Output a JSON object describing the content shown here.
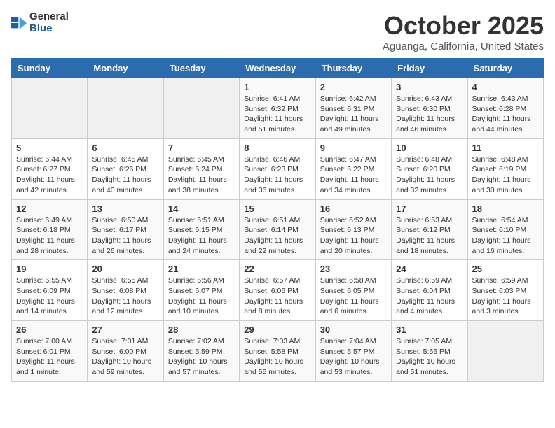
{
  "header": {
    "logo": {
      "text_general": "General",
      "text_blue": "Blue"
    },
    "title": "October 2025",
    "subtitle": "Aguanga, California, United States"
  },
  "weekdays": [
    "Sunday",
    "Monday",
    "Tuesday",
    "Wednesday",
    "Thursday",
    "Friday",
    "Saturday"
  ],
  "weeks": [
    [
      {
        "day": null
      },
      {
        "day": null
      },
      {
        "day": null
      },
      {
        "day": "1",
        "sunrise": "Sunrise: 6:41 AM",
        "sunset": "Sunset: 6:32 PM",
        "daylight": "Daylight: 11 hours and 51 minutes."
      },
      {
        "day": "2",
        "sunrise": "Sunrise: 6:42 AM",
        "sunset": "Sunset: 6:31 PM",
        "daylight": "Daylight: 11 hours and 49 minutes."
      },
      {
        "day": "3",
        "sunrise": "Sunrise: 6:43 AM",
        "sunset": "Sunset: 6:30 PM",
        "daylight": "Daylight: 11 hours and 46 minutes."
      },
      {
        "day": "4",
        "sunrise": "Sunrise: 6:43 AM",
        "sunset": "Sunset: 6:28 PM",
        "daylight": "Daylight: 11 hours and 44 minutes."
      }
    ],
    [
      {
        "day": "5",
        "sunrise": "Sunrise: 6:44 AM",
        "sunset": "Sunset: 6:27 PM",
        "daylight": "Daylight: 11 hours and 42 minutes."
      },
      {
        "day": "6",
        "sunrise": "Sunrise: 6:45 AM",
        "sunset": "Sunset: 6:26 PM",
        "daylight": "Daylight: 11 hours and 40 minutes."
      },
      {
        "day": "7",
        "sunrise": "Sunrise: 6:45 AM",
        "sunset": "Sunset: 6:24 PM",
        "daylight": "Daylight: 11 hours and 38 minutes."
      },
      {
        "day": "8",
        "sunrise": "Sunrise: 6:46 AM",
        "sunset": "Sunset: 6:23 PM",
        "daylight": "Daylight: 11 hours and 36 minutes."
      },
      {
        "day": "9",
        "sunrise": "Sunrise: 6:47 AM",
        "sunset": "Sunset: 6:22 PM",
        "daylight": "Daylight: 11 hours and 34 minutes."
      },
      {
        "day": "10",
        "sunrise": "Sunrise: 6:48 AM",
        "sunset": "Sunset: 6:20 PM",
        "daylight": "Daylight: 11 hours and 32 minutes."
      },
      {
        "day": "11",
        "sunrise": "Sunrise: 6:48 AM",
        "sunset": "Sunset: 6:19 PM",
        "daylight": "Daylight: 11 hours and 30 minutes."
      }
    ],
    [
      {
        "day": "12",
        "sunrise": "Sunrise: 6:49 AM",
        "sunset": "Sunset: 6:18 PM",
        "daylight": "Daylight: 11 hours and 28 minutes."
      },
      {
        "day": "13",
        "sunrise": "Sunrise: 6:50 AM",
        "sunset": "Sunset: 6:17 PM",
        "daylight": "Daylight: 11 hours and 26 minutes."
      },
      {
        "day": "14",
        "sunrise": "Sunrise: 6:51 AM",
        "sunset": "Sunset: 6:15 PM",
        "daylight": "Daylight: 11 hours and 24 minutes."
      },
      {
        "day": "15",
        "sunrise": "Sunrise: 6:51 AM",
        "sunset": "Sunset: 6:14 PM",
        "daylight": "Daylight: 11 hours and 22 minutes."
      },
      {
        "day": "16",
        "sunrise": "Sunrise: 6:52 AM",
        "sunset": "Sunset: 6:13 PM",
        "daylight": "Daylight: 11 hours and 20 minutes."
      },
      {
        "day": "17",
        "sunrise": "Sunrise: 6:53 AM",
        "sunset": "Sunset: 6:12 PM",
        "daylight": "Daylight: 11 hours and 18 minutes."
      },
      {
        "day": "18",
        "sunrise": "Sunrise: 6:54 AM",
        "sunset": "Sunset: 6:10 PM",
        "daylight": "Daylight: 11 hours and 16 minutes."
      }
    ],
    [
      {
        "day": "19",
        "sunrise": "Sunrise: 6:55 AM",
        "sunset": "Sunset: 6:09 PM",
        "daylight": "Daylight: 11 hours and 14 minutes."
      },
      {
        "day": "20",
        "sunrise": "Sunrise: 6:55 AM",
        "sunset": "Sunset: 6:08 PM",
        "daylight": "Daylight: 11 hours and 12 minutes."
      },
      {
        "day": "21",
        "sunrise": "Sunrise: 6:56 AM",
        "sunset": "Sunset: 6:07 PM",
        "daylight": "Daylight: 11 hours and 10 minutes."
      },
      {
        "day": "22",
        "sunrise": "Sunrise: 6:57 AM",
        "sunset": "Sunset: 6:06 PM",
        "daylight": "Daylight: 11 hours and 8 minutes."
      },
      {
        "day": "23",
        "sunrise": "Sunrise: 6:58 AM",
        "sunset": "Sunset: 6:05 PM",
        "daylight": "Daylight: 11 hours and 6 minutes."
      },
      {
        "day": "24",
        "sunrise": "Sunrise: 6:59 AM",
        "sunset": "Sunset: 6:04 PM",
        "daylight": "Daylight: 11 hours and 4 minutes."
      },
      {
        "day": "25",
        "sunrise": "Sunrise: 6:59 AM",
        "sunset": "Sunset: 6:03 PM",
        "daylight": "Daylight: 11 hours and 3 minutes."
      }
    ],
    [
      {
        "day": "26",
        "sunrise": "Sunrise: 7:00 AM",
        "sunset": "Sunset: 6:01 PM",
        "daylight": "Daylight: 11 hours and 1 minute."
      },
      {
        "day": "27",
        "sunrise": "Sunrise: 7:01 AM",
        "sunset": "Sunset: 6:00 PM",
        "daylight": "Daylight: 10 hours and 59 minutes."
      },
      {
        "day": "28",
        "sunrise": "Sunrise: 7:02 AM",
        "sunset": "Sunset: 5:59 PM",
        "daylight": "Daylight: 10 hours and 57 minutes."
      },
      {
        "day": "29",
        "sunrise": "Sunrise: 7:03 AM",
        "sunset": "Sunset: 5:58 PM",
        "daylight": "Daylight: 10 hours and 55 minutes."
      },
      {
        "day": "30",
        "sunrise": "Sunrise: 7:04 AM",
        "sunset": "Sunset: 5:57 PM",
        "daylight": "Daylight: 10 hours and 53 minutes."
      },
      {
        "day": "31",
        "sunrise": "Sunrise: 7:05 AM",
        "sunset": "Sunset: 5:56 PM",
        "daylight": "Daylight: 10 hours and 51 minutes."
      },
      {
        "day": null
      }
    ]
  ]
}
